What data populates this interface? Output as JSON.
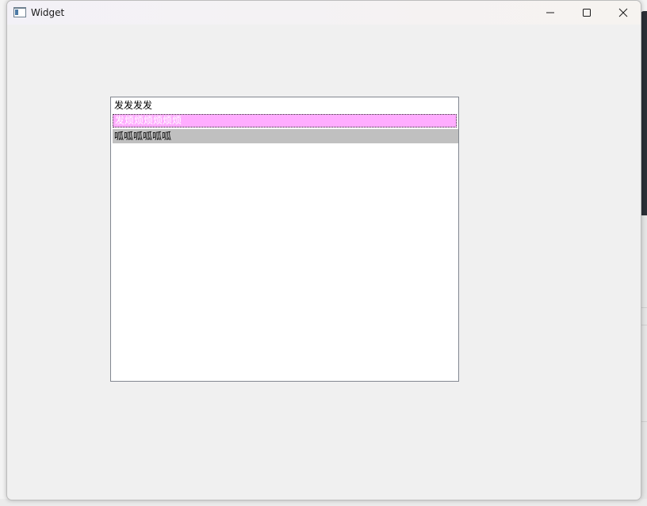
{
  "window": {
    "title": "Widget",
    "icon": "app-window-icon",
    "controls": {
      "minimize_icon": "minimize-icon",
      "maximize_icon": "maximize-icon",
      "close_icon": "close-icon"
    }
  },
  "list": {
    "items": [
      {
        "label": "发发发发",
        "state": "normal"
      },
      {
        "label": "发烦烦烦烦烦烦",
        "state": "hover",
        "bg_color": "#ffadff",
        "text_color": "#ffffff"
      },
      {
        "label": "呱呱呱呱呱呱",
        "state": "selected",
        "bg_color": "#c0c0c0",
        "text_color": "#000000"
      }
    ]
  },
  "colors": {
    "window_bg": "#f0f0f0",
    "list_bg": "#ffffff",
    "list_border": "#828790"
  }
}
